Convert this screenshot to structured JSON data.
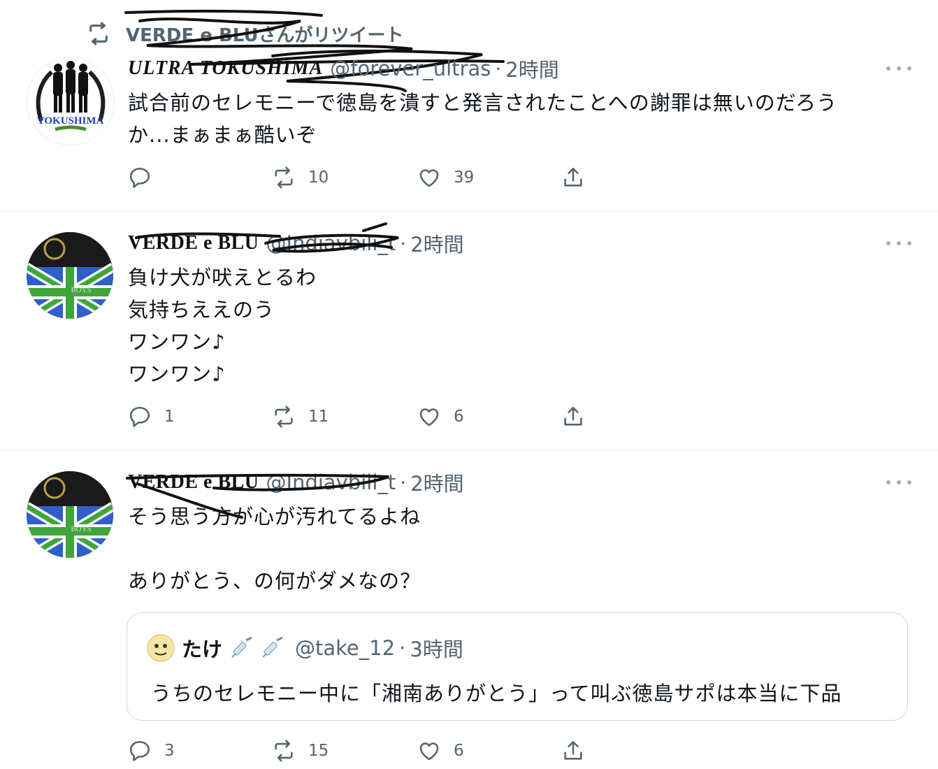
{
  "retweet_banner": {
    "text": "VERDE e BLUさんがリツイート",
    "icon": "retweet-icon"
  },
  "tweets": [
    {
      "name": "ULTRA TOKUSHIMA",
      "handle": "@forever_ultras",
      "time": "2時間",
      "text": "試合前のセレモニーで徳島を潰すと発言されたことへの謝罪は無いのだろう\nか...まぁまぁ酷いぞ",
      "avatar_label": "TOKUSHIMA",
      "replies": "",
      "retweets": "10",
      "likes": "39"
    },
    {
      "name": "VERDE e BLU",
      "handle": "@Indiavbili_t",
      "time": "2時間",
      "text": "負け犬が吠えとるわ\n気持ちええのう\nワンワン♪\nワンワン♪",
      "avatar_label": "BOYS",
      "replies": "1",
      "retweets": "11",
      "likes": "6"
    },
    {
      "name": "VERDE e BLU",
      "handle": "@Indiavbili_t",
      "time": "2時間",
      "text": "そう思う方が心が汚れてるよね\n\nありがとう、の何がダメなの？",
      "avatar_label": "BOYS",
      "replies": "3",
      "retweets": "15",
      "likes": "6",
      "quote": {
        "name": "たけ",
        "emoji": "syringe-icon",
        "handle": "@take_12",
        "time": "3時間",
        "text": "うちのセレモニー中に「湘南ありがとう」って叫ぶ徳島サポは本当に下品"
      }
    }
  ],
  "colors": {
    "secondary_text": "#536471",
    "divider": "#e6e9ec",
    "accent_green": "#3c8a3a",
    "accent_blue": "#1f4fb6"
  }
}
